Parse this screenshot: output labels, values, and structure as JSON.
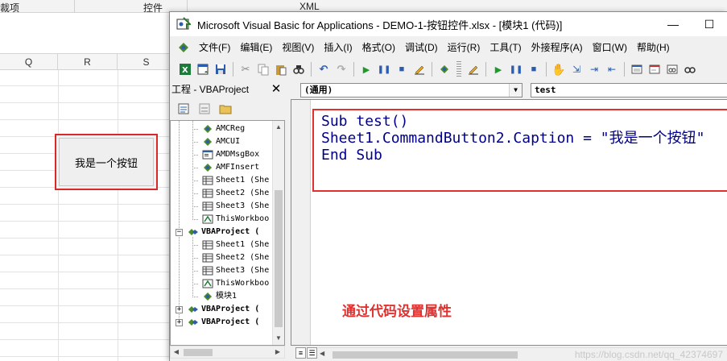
{
  "excel": {
    "ribbon_left_label": "裁项",
    "ribbon_mid_label": "控件",
    "ribbon_right_label": "XML",
    "columns": [
      "Q",
      "R",
      "S"
    ],
    "sheet_button_label": "我是一个按钮"
  },
  "vba": {
    "title": "Microsoft Visual Basic for Applications - DEMO-1-按钮控件.xlsx - [模块1 (代码)]",
    "minimize_label": "—",
    "maximize_label": "☐",
    "menu": [
      "文件(F)",
      "编辑(E)",
      "视图(V)",
      "插入(I)",
      "格式(O)",
      "调试(D)",
      "运行(R)",
      "工具(T)",
      "外接程序(A)",
      "窗口(W)",
      "帮助(H)"
    ],
    "project": {
      "title": "工程 - VBAProject",
      "close_label": "✕",
      "tree": [
        {
          "label": "AMCReg",
          "icon": "module-icon"
        },
        {
          "label": "AMCUI",
          "icon": "module-icon"
        },
        {
          "label": "AMDMsgBox",
          "icon": "form-icon"
        },
        {
          "label": "AMFInsert",
          "icon": "module-icon"
        },
        {
          "label": "Sheet1 (She",
          "icon": "sheet-icon"
        },
        {
          "label": "Sheet2 (She",
          "icon": "sheet-icon"
        },
        {
          "label": "Sheet3 (She",
          "icon": "sheet-icon"
        },
        {
          "label": "ThisWorkboo",
          "icon": "workbook-icon"
        },
        {
          "label": "VBAProject (",
          "icon": "project-icon"
        },
        {
          "label": "Sheet1 (She",
          "icon": "sheet-icon"
        },
        {
          "label": "Sheet2 (She",
          "icon": "sheet-icon"
        },
        {
          "label": "Sheet3 (She",
          "icon": "sheet-icon"
        },
        {
          "label": "ThisWorkboo",
          "icon": "workbook-icon"
        },
        {
          "label": "模块1",
          "icon": "module-icon"
        },
        {
          "label": "VBAProject (",
          "icon": "project-icon"
        },
        {
          "label": "VBAProject (",
          "icon": "project-icon"
        }
      ]
    },
    "code": {
      "object_combo": "(通用)",
      "proc_combo": "test",
      "lines": [
        {
          "kw1": "Sub",
          "rest": " test()"
        },
        {
          "text": "Sheet1.CommandButton2.Caption = \"我是一个按钮\""
        },
        {
          "kw1": "End Sub",
          "rest": ""
        }
      ],
      "annotation": "通过代码设置属性"
    },
    "watermark": "https://blog.csdn.net/qq_42374697"
  }
}
